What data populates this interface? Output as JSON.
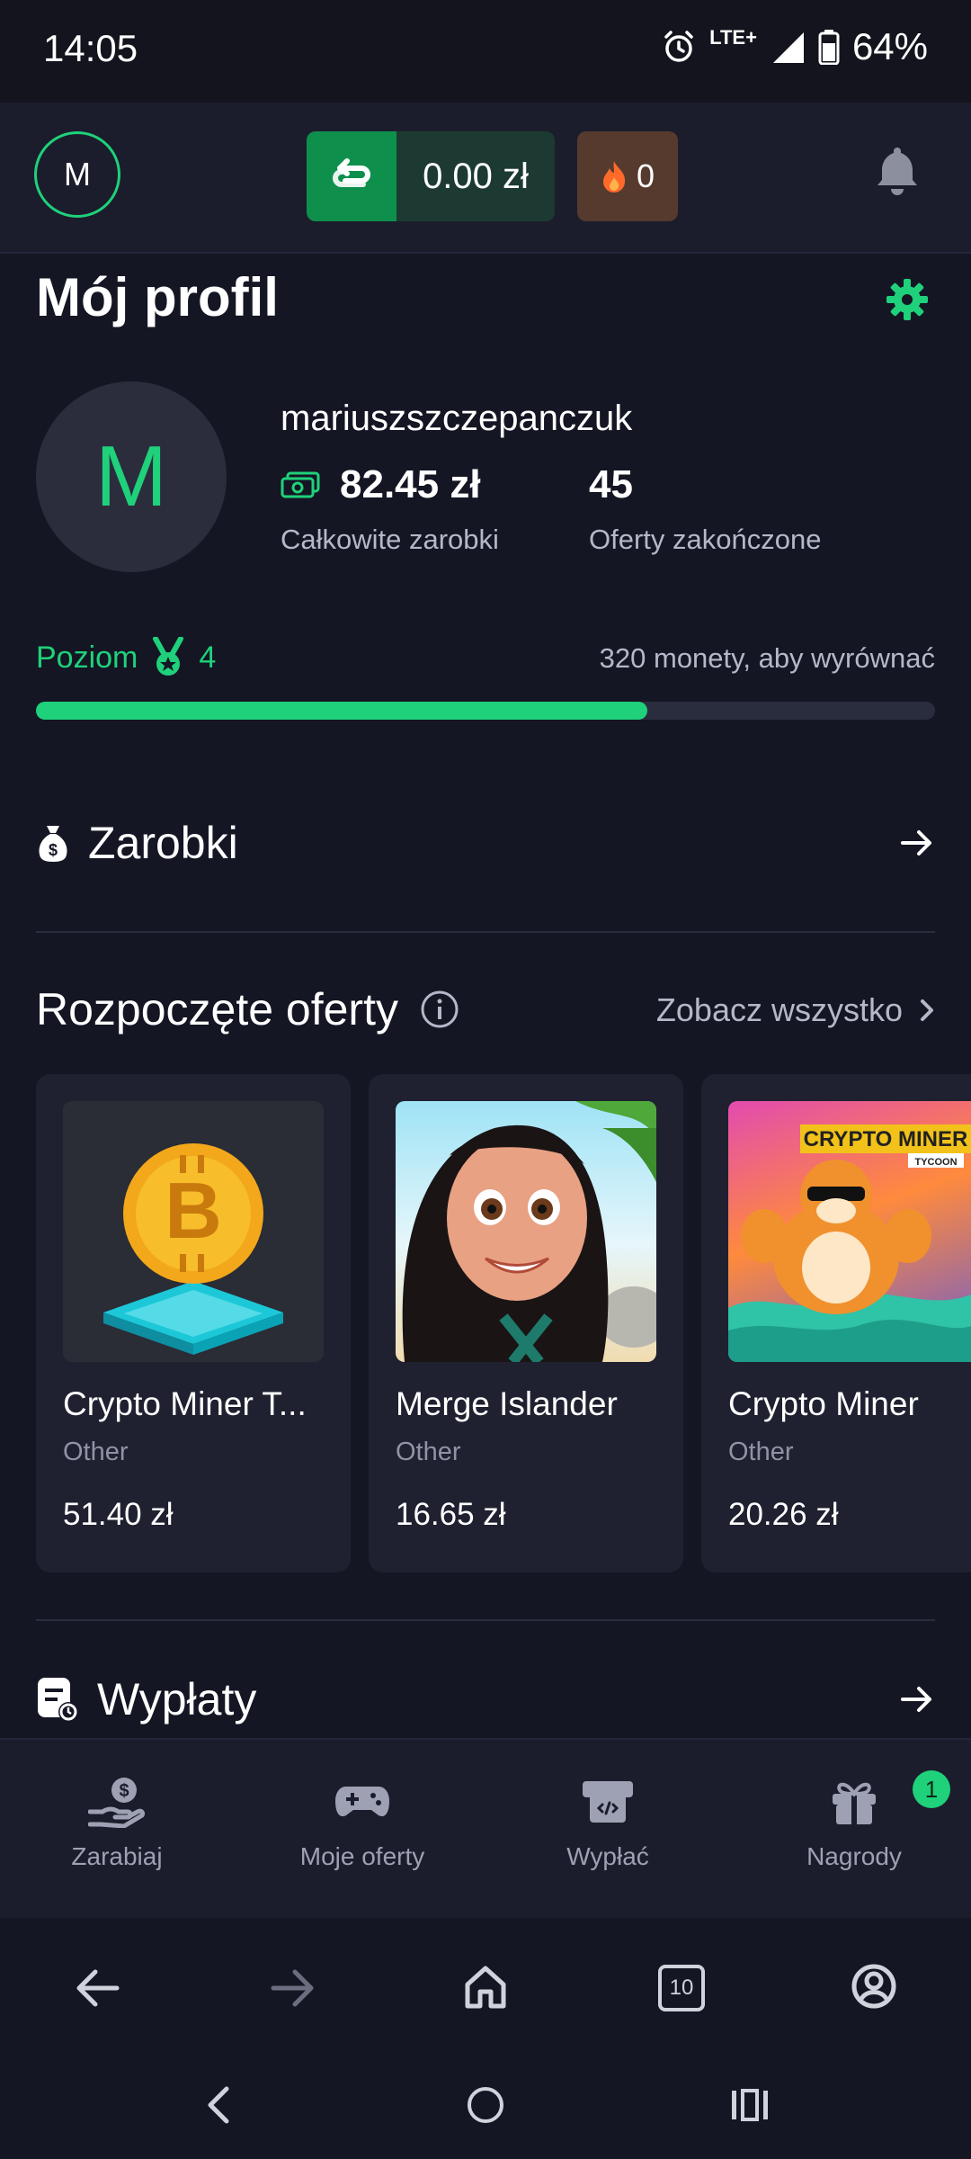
{
  "status_bar": {
    "time": "14:05",
    "network": "LTE+",
    "battery": "64%"
  },
  "header": {
    "avatar_letter": "M",
    "balance": "0.00 zł",
    "streak": "0"
  },
  "profile": {
    "title": "Mój profil",
    "avatar_letter": "M",
    "username": "mariuszszczepanczuk",
    "total_earnings": "82.45 zł",
    "total_earnings_label": "Całkowite zarobki",
    "offers_completed": "45",
    "offers_completed_label": "Oferty zakończone"
  },
  "level": {
    "label": "Poziom",
    "value": "4",
    "hint": "320 monety, aby wyrównać",
    "progress_fraction": 0.68
  },
  "sections": {
    "earnings": "Zarobki",
    "started_offers": "Rozpoczęte oferty",
    "see_all": "Zobacz wszystko",
    "payouts": "Wypłaty"
  },
  "offers": [
    {
      "name": "Crypto Miner T...",
      "category": "Other",
      "price": "51.40 zł"
    },
    {
      "name": "Merge Islander",
      "category": "Other",
      "price": "16.65 zł"
    },
    {
      "name": "Crypto Miner",
      "category": "Other",
      "price": "20.26 zł",
      "banner": "CRYPTO MINER",
      "banner_sub": "TYCOON"
    }
  ],
  "bottom_nav": [
    {
      "label": "Zarabiaj",
      "icon": "hand-coin-icon"
    },
    {
      "label": "Moje oferty",
      "icon": "gamepad-icon"
    },
    {
      "label": "Wypłać",
      "icon": "wallet-icon"
    },
    {
      "label": "Nagrody",
      "icon": "gift-icon",
      "badge": "1"
    }
  ],
  "browser": {
    "tab_count": "10"
  },
  "colors": {
    "accent": "#1fd17a",
    "background": "#141624",
    "header": "#1b1d2c",
    "card": "#1f2130"
  }
}
